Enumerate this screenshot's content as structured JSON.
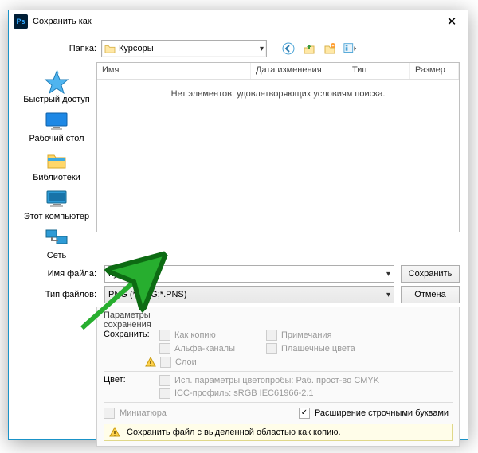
{
  "title": "Сохранить как",
  "folder_label": "Папка:",
  "folder_name": "Курсоры",
  "columns": {
    "name": "Имя",
    "date": "Дата изменения",
    "type": "Тип",
    "size": "Размер"
  },
  "empty_msg": "Нет элементов, удовлетворяющих условиям поиска.",
  "places": {
    "quick": "Быстрый доступ",
    "desktop": "Рабочий стол",
    "libraries": "Библиотеки",
    "computer": "Этот компьютер",
    "network": "Сеть"
  },
  "filename_label": "Имя файла:",
  "filename_value": "Курсор.png",
  "filetype_label": "Тип файлов:",
  "filetype_value": "PNG (*.PNG;*.PNS)",
  "save_btn": "Сохранить",
  "cancel_btn": "Отмена",
  "options": {
    "header_params": "Параметры сохранения",
    "header_save": "Сохранить:",
    "as_copy": "Как копию",
    "notes": "Примечания",
    "alpha": "Альфа-каналы",
    "spot": "Плашечные цвета",
    "layers": "Слои",
    "color_label": "Цвет:",
    "cmyk": "Исп. параметры цветопробы:  Раб. прост-во CMYK",
    "icc": "ICC-профиль: sRGB IEC61966-2.1",
    "thumb": "Миниатюра",
    "lowercase": "Расширение строчными буквами",
    "info": "Сохранить файл с выделенной областью как копию."
  }
}
